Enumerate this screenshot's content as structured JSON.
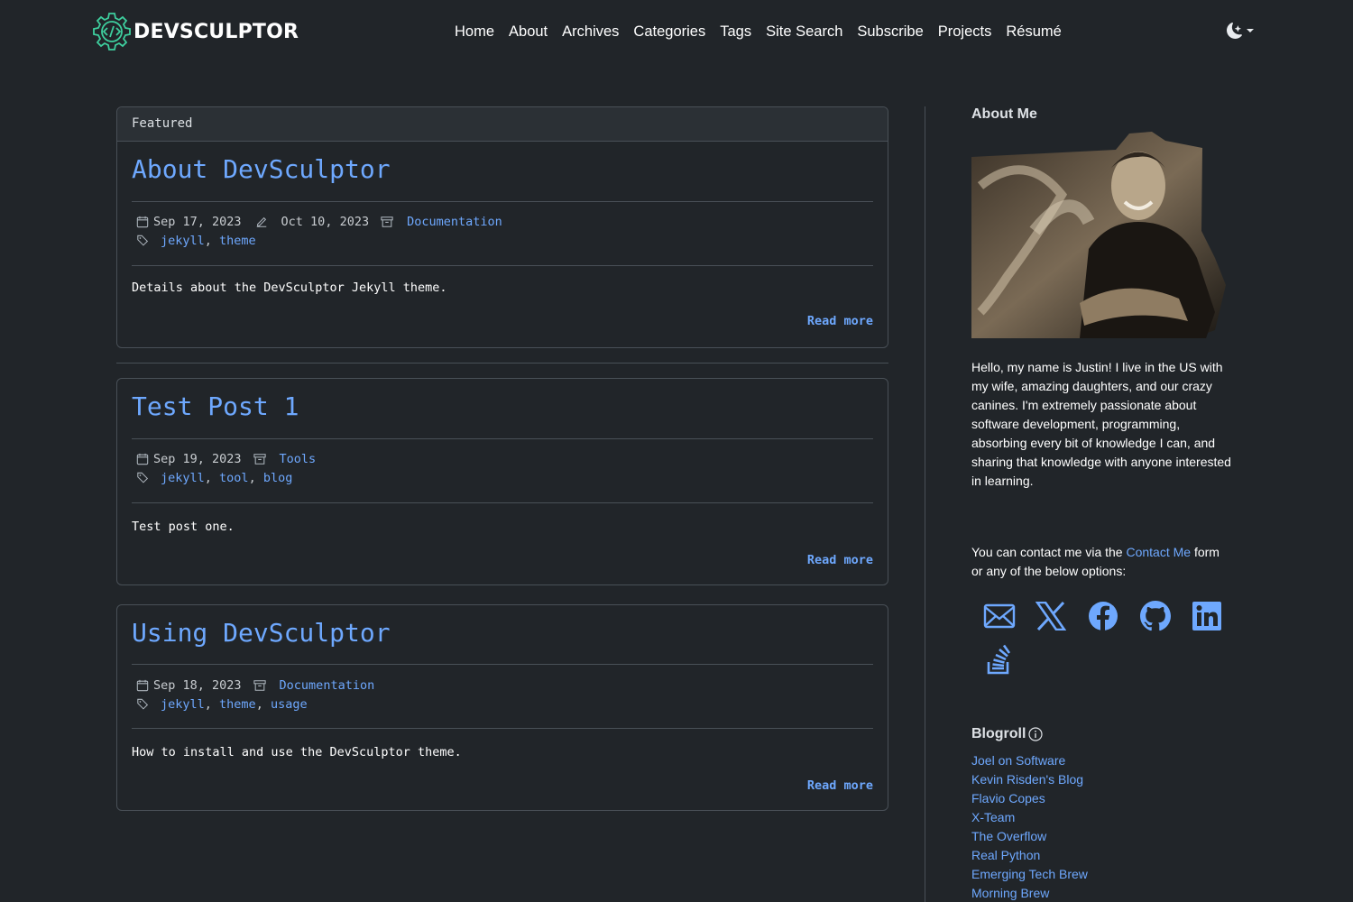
{
  "brand": {
    "name": "DEVSCULPTOR",
    "accent": "#3ecf9e"
  },
  "nav": {
    "items": [
      "Home",
      "About",
      "Archives",
      "Categories",
      "Tags",
      "Site Search",
      "Subscribe",
      "Projects",
      "Résumé"
    ]
  },
  "theme_toggle": {
    "icon": "moon-stars-icon"
  },
  "colors": {
    "background": "#212529",
    "link": "#6ea8fe",
    "border": "#495057"
  },
  "featured": {
    "header": "Featured",
    "title": "About DevSculptor",
    "posted": "Sep 17, 2023",
    "updated": "Oct 10, 2023",
    "category": "Documentation",
    "tags": [
      "jekyll",
      "theme"
    ],
    "excerpt": "Details about the DevSculptor Jekyll theme.",
    "read_more": "Read more"
  },
  "posts": [
    {
      "title": "Test Post 1",
      "posted": "Sep 19, 2023",
      "category": "Tools",
      "tags": [
        "jekyll",
        "tool",
        "blog"
      ],
      "excerpt": "Test post one.",
      "read_more": "Read more"
    },
    {
      "title": "Using DevSculptor",
      "posted": "Sep 18, 2023",
      "category": "Documentation",
      "tags": [
        "jekyll",
        "theme",
        "usage"
      ],
      "excerpt": "How to install and use the DevSculptor theme.",
      "read_more": "Read more"
    }
  ],
  "sidebar": {
    "about_heading": "About Me",
    "bio": "Hello, my name is Justin! I live in the US with my wife, amazing daughters, and our crazy canines. I'm extremely passionate about software development, programming, absorbing every bit of knowledge I can, and sharing that knowledge with anyone interested in learning.",
    "contact_prefix": "You can contact me via the",
    "contact_link": "Contact Me",
    "contact_suffix": "form or any of the below options:",
    "social": [
      "envelope-icon",
      "x-twitter-icon",
      "facebook-icon",
      "github-icon",
      "linkedin-icon",
      "stack-overflow-icon"
    ],
    "blogroll_heading": "Blogroll",
    "blogroll": [
      "Joel on Software",
      "Kevin Risden's Blog",
      "Flavio Copes",
      "X-Team",
      "The Overflow",
      "Real Python",
      "Emerging Tech Brew",
      "Morning Brew"
    ]
  }
}
